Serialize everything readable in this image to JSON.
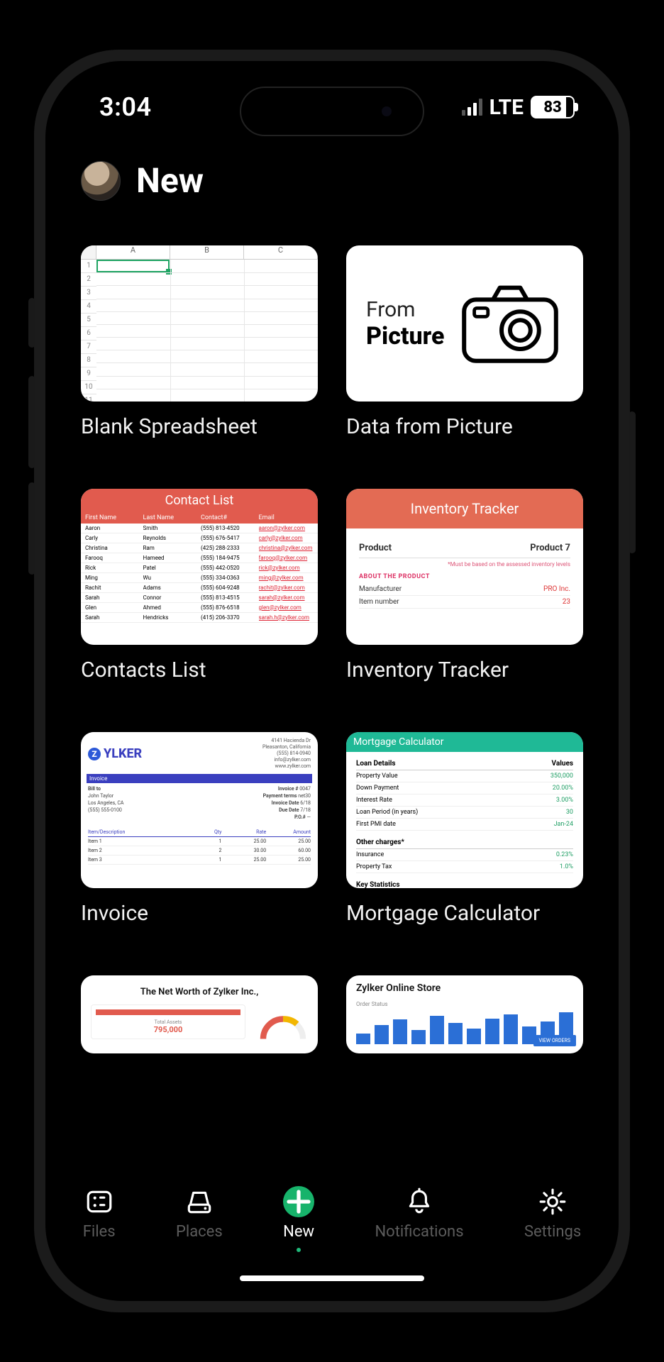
{
  "statusbar": {
    "time": "3:04",
    "network_label": "LTE",
    "battery_percent": "83",
    "signal_active_bars": 2,
    "signal_total_bars": 4
  },
  "header": {
    "title": "New"
  },
  "templates": [
    {
      "id": "blank",
      "label": "Blank Spreadsheet",
      "preview": {
        "columns": [
          "A",
          "B",
          "C"
        ],
        "row_count": 11,
        "selected_cell": "A1"
      }
    },
    {
      "id": "from-picture",
      "label": "Data from Picture",
      "preview": {
        "line1": "From",
        "line2": "Picture"
      }
    },
    {
      "id": "contacts",
      "label": "Contacts List",
      "preview": {
        "title": "Contact List",
        "headers": [
          "First Name",
          "Last Name",
          "Contact#",
          "Email"
        ],
        "rows": [
          [
            "Aaron",
            "Smith",
            "(555) 813-4520",
            "aaron@zylker.com"
          ],
          [
            "Carly",
            "Reynolds",
            "(555) 676-5417",
            "carly@zylker.com"
          ],
          [
            "Christina",
            "Ram",
            "(425) 288-2333",
            "christina@zylker.com"
          ],
          [
            "Farooq",
            "Hameed",
            "(555) 184-9475",
            "farooq@zylker.com"
          ],
          [
            "Rick",
            "Patel",
            "(555) 442-0520",
            "rick@zylker.com"
          ],
          [
            "Ming",
            "Wu",
            "(555) 334-0363",
            "ming@zylker.com"
          ],
          [
            "Rachit",
            "Adams",
            "(555) 604-9248",
            "rachit@zylker.com"
          ],
          [
            "Sarah",
            "Connor",
            "(555) 813-4515",
            "sarah@zylker.com"
          ],
          [
            "Glen",
            "Ahmed",
            "(555) 876-6518",
            "glen@zylker.com"
          ],
          [
            "Sarah",
            "Hendricks",
            "(415) 206-3370",
            "sarah.h@zylker.com"
          ]
        ]
      }
    },
    {
      "id": "inventory",
      "label": "Inventory Tracker",
      "preview": {
        "title": "Inventory Tracker",
        "product_label": "Product",
        "product_value": "Product 7",
        "note": "*Must be based on the assessed inventory levels",
        "section": "ABOUT THE PRODUCT",
        "rows": [
          {
            "l": "Manufacturer",
            "r": "PRO Inc."
          },
          {
            "l": "Item number",
            "r": "23"
          }
        ]
      }
    },
    {
      "id": "invoice",
      "label": "Invoice",
      "preview": {
        "brand": "YLKER",
        "brand_prefix": "Z",
        "bar": "Invoice",
        "addr": [
          "4141 Hacienda Dr",
          "Pleasanton, California",
          "(555) 814-0940",
          "info@zylker.com",
          "www.zylker.com"
        ],
        "bill_to_label": "Bill to",
        "bill_to": [
          "John Taylor",
          "Los Angeles, CA",
          "(555) 555-0100"
        ],
        "meta": [
          [
            "Invoice #",
            "0047"
          ],
          [
            "Payment terms",
            "net30"
          ],
          [
            "Invoice Date",
            "6/18"
          ],
          [
            "Due Date",
            "7/18"
          ],
          [
            "P.O.#",
            "—"
          ]
        ],
        "table_headers": [
          "Item/Description",
          "Qty",
          "Rate",
          "Amount"
        ],
        "table_rows": [
          [
            "Item 1",
            "1",
            "25.00",
            "25.00"
          ],
          [
            "Item 2",
            "2",
            "30.00",
            "60.00"
          ],
          [
            "Item 3",
            "1",
            "25.00",
            "25.00"
          ]
        ]
      }
    },
    {
      "id": "mortgage",
      "label": "Mortgage Calculator",
      "preview": {
        "title": "Mortgage Calculator",
        "section1": {
          "l": "Loan Details",
          "r": "Values"
        },
        "rows": [
          {
            "l": "Property Value",
            "v": "350,000"
          },
          {
            "l": "Down Payment",
            "v": "20.00%"
          },
          {
            "l": "Interest Rate",
            "v": "3.00%"
          },
          {
            "l": "Loan Period (in years)",
            "v": "30"
          },
          {
            "l": "First PMI date",
            "v": "Jan-24"
          }
        ],
        "section2": "Other charges*",
        "rows2": [
          {
            "l": "Insurance",
            "v": "0.23%"
          },
          {
            "l": "Property Tax",
            "v": "1.0%"
          }
        ],
        "section3": "Key Statistics"
      }
    },
    {
      "id": "networth",
      "label": "",
      "preview": {
        "title": "The Net Worth of Zylker Inc.,",
        "card_label": "Total Assets",
        "card_value": "795,000"
      }
    },
    {
      "id": "sales",
      "label": "",
      "preview": {
        "title": "Zylker Online Store",
        "sub": "Order Status",
        "bars": [
          30,
          55,
          70,
          40,
          80,
          60,
          45,
          72,
          85,
          50,
          64,
          90
        ],
        "button": "VIEW ORDERS"
      }
    }
  ],
  "tabbar": {
    "items": [
      {
        "id": "files",
        "label": "Files"
      },
      {
        "id": "places",
        "label": "Places"
      },
      {
        "id": "new",
        "label": "New",
        "active": true
      },
      {
        "id": "notifications",
        "label": "Notifications"
      },
      {
        "id": "settings",
        "label": "Settings"
      }
    ]
  }
}
